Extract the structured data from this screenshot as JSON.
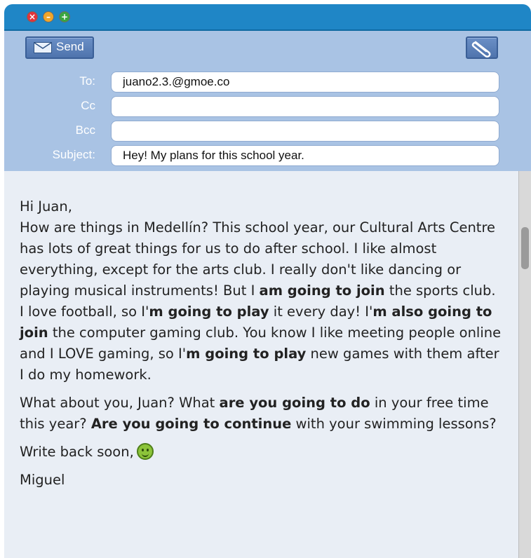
{
  "window": {
    "controls": [
      "close",
      "minimize",
      "maximize"
    ]
  },
  "toolbar": {
    "send_label": "Send",
    "send_icon": "envelope-icon",
    "attach_icon": "paperclip-icon"
  },
  "fields": {
    "to": {
      "label": "To:",
      "value": "juano2.3.@gmoe.co"
    },
    "cc": {
      "label": "Cc",
      "value": ""
    },
    "bcc": {
      "label": "Bcc",
      "value": ""
    },
    "subject": {
      "label": "Subject:",
      "value": "Hey! My plans for this school year."
    }
  },
  "message": {
    "p1": [
      "Hi Juan,",
      "How are things in Medellín? This school year, our Cultural Arts Centre has lots of great things for us to do after school. I like almost everything, except for the arts club. I really don't like dancing or playing musical instruments! But I ",
      "am going to join",
      " the sports club. I love football, so I'",
      "m going to play",
      " it every day! I'",
      "m also going to join",
      " the computer gaming club. You know I like meeting people online and I LOVE gaming, so I'",
      "m going to play",
      " new games with them after I do my homework."
    ],
    "p2": [
      "What about you, Juan? What ",
      "are you going to do",
      " in your free time this year? ",
      "Are you going to continue",
      " with your swimming lessons?"
    ],
    "signoff": "Write back soon,",
    "signoff_icon": "smiley-icon",
    "signature": "Miguel"
  },
  "colors": {
    "titlebar": "#1f86c6",
    "header": "#a9c3e4",
    "body": "#e9eef5"
  }
}
